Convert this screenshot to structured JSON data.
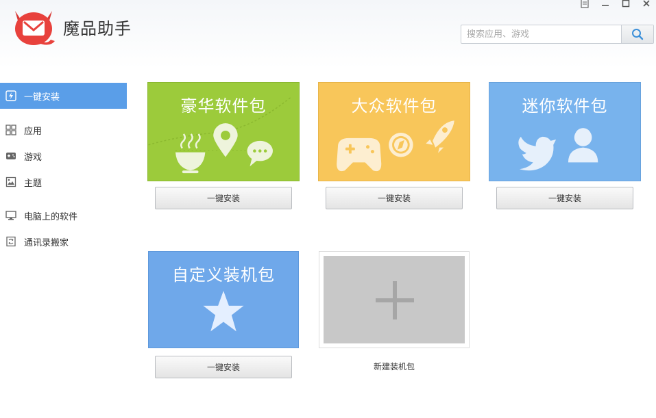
{
  "app": {
    "title": "魔品助手",
    "logo_icon": "devil-mail-logo-icon",
    "brand_color": "#e8413c"
  },
  "window_controls": [
    "menu-icon",
    "minimize-icon",
    "maximize-icon",
    "close-icon"
  ],
  "search": {
    "placeholder": "搜索应用、游戏",
    "button_icon": "search-icon",
    "accent": "#3b8fd9"
  },
  "sidebar": {
    "items": [
      {
        "label": "一键安装",
        "icon": "lightning-icon",
        "active": true
      },
      {
        "label": "应用",
        "icon": "grid-icon",
        "active": false
      },
      {
        "label": "游戏",
        "icon": "gamepad-icon",
        "active": false
      },
      {
        "label": "主题",
        "icon": "image-icon",
        "active": false
      },
      {
        "label": "电脑上的软件",
        "icon": "monitor-icon",
        "active": false
      },
      {
        "label": "通讯录搬家",
        "icon": "contacts-transfer-icon",
        "active": false
      }
    ],
    "active_color": "#5a9ee8"
  },
  "packages": [
    {
      "title": "豪华软件包",
      "color": "#9ccb3b",
      "button": "一键安装"
    },
    {
      "title": "大众软件包",
      "color": "#f8c65a",
      "button": "一键安装"
    },
    {
      "title": "迷你软件包",
      "color": "#78b3ed",
      "button": "一键安装"
    },
    {
      "title": "自定义装机包",
      "color": "#6fa8ea",
      "button": "一键安装"
    }
  ],
  "new_package": {
    "label": "新建装机包",
    "icon": "plus-icon"
  }
}
